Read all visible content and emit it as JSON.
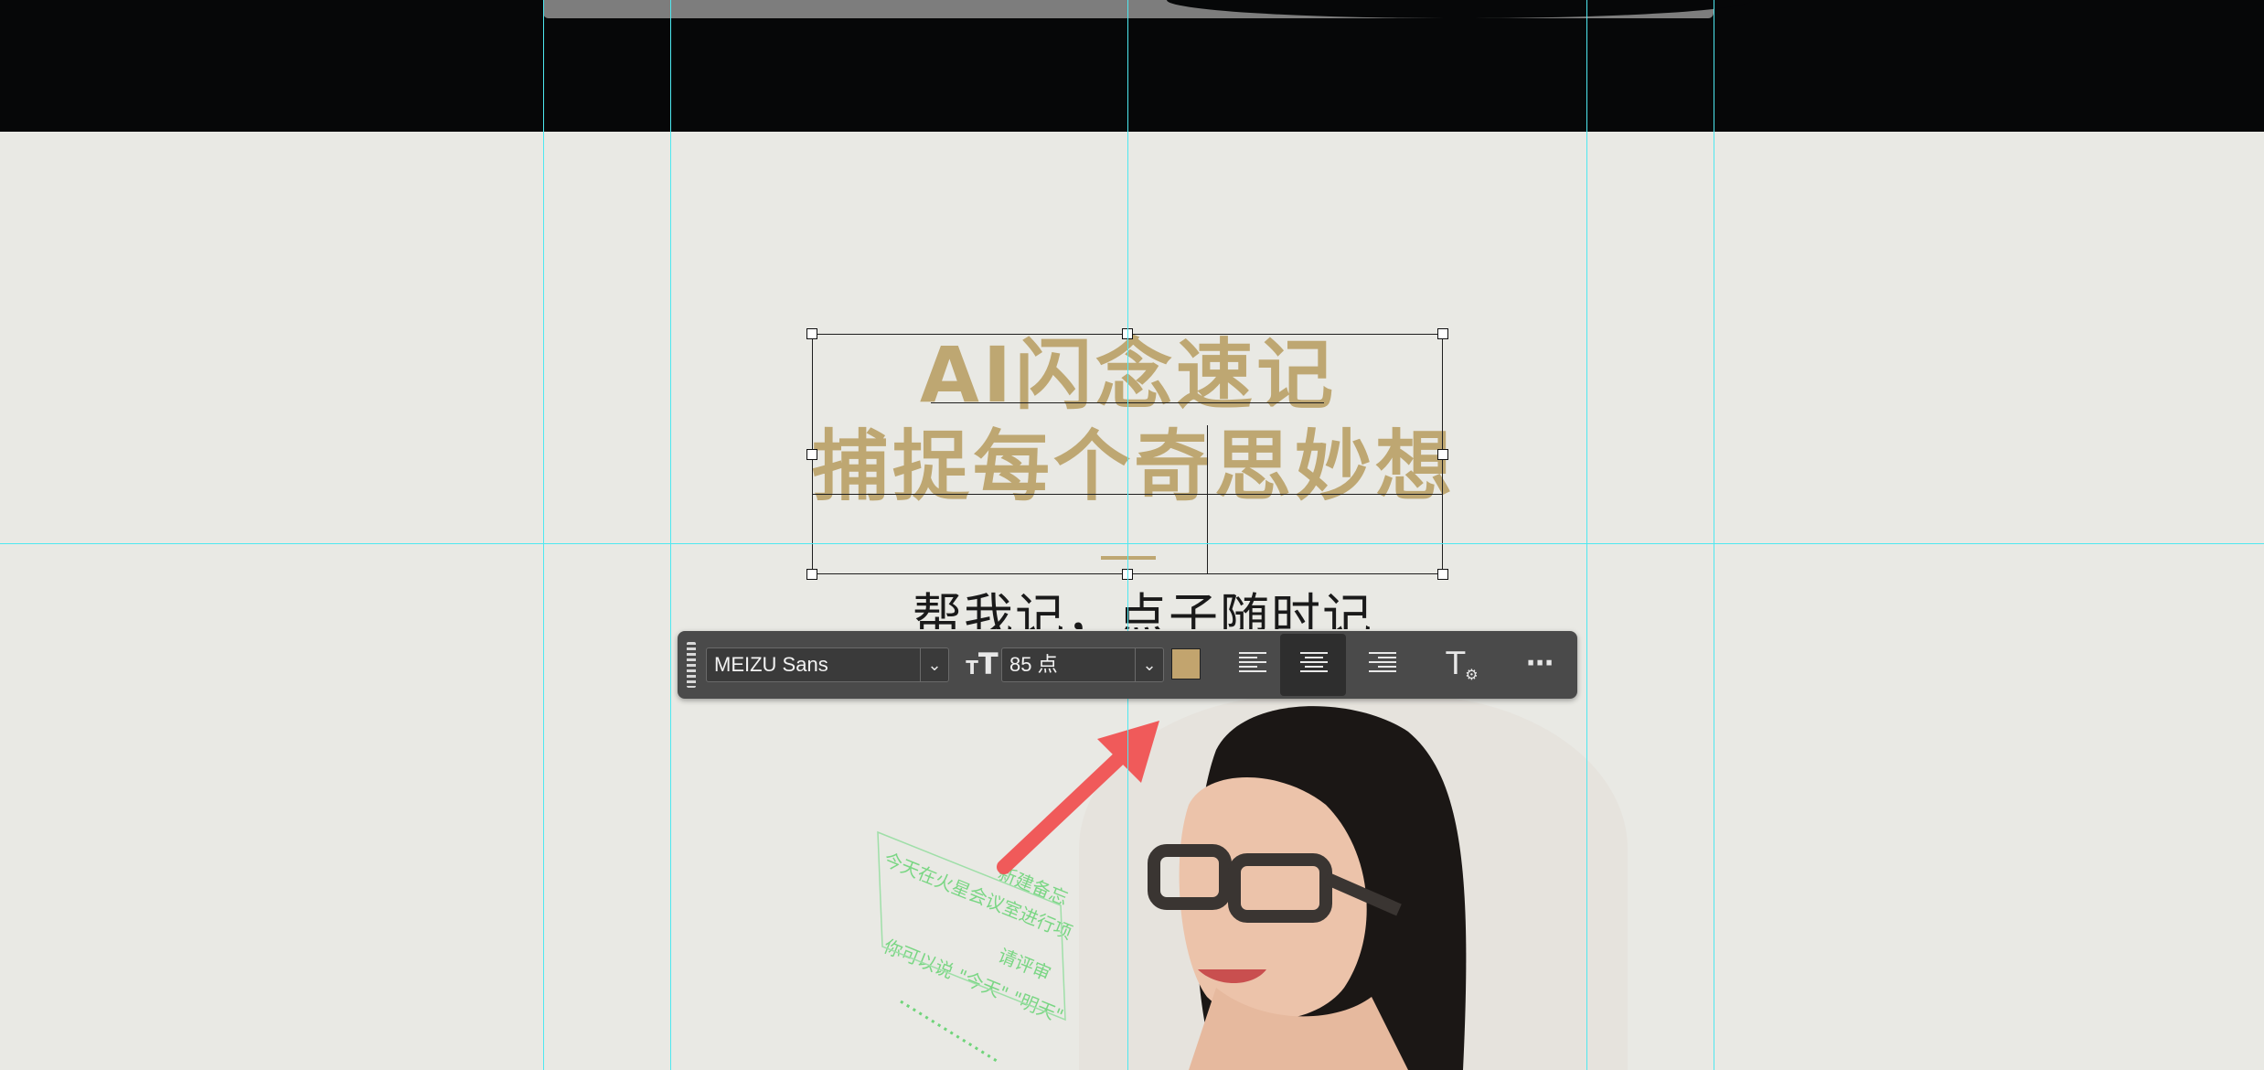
{
  "artboard": {
    "title_line1": "AI闪念速记",
    "title_line2": "捕捉每个奇思妙想",
    "subtitle": "帮我记，点子随时记",
    "title_color": "#bea772",
    "ar_overlay_lines": [
      "新建备忘",
      "今天在火星会议室进行项",
      "请评审",
      "你可以说 \"今天\" \"明天\""
    ]
  },
  "toolbar": {
    "font_family": "MEIZU Sans",
    "font_size": "85 点",
    "color_swatch": "#c2a46e",
    "align_options": [
      "align-left",
      "align-center",
      "align-right"
    ],
    "align_selected": "align-center",
    "text_options_icon": "text-options-icon",
    "more_icon": "more-icon"
  },
  "colors": {
    "guide": "#4ee8f0",
    "toolbar_bg": "#4a4a4a",
    "canvas_bg": "#e9e9e4",
    "arrow": "#f05a5a"
  }
}
